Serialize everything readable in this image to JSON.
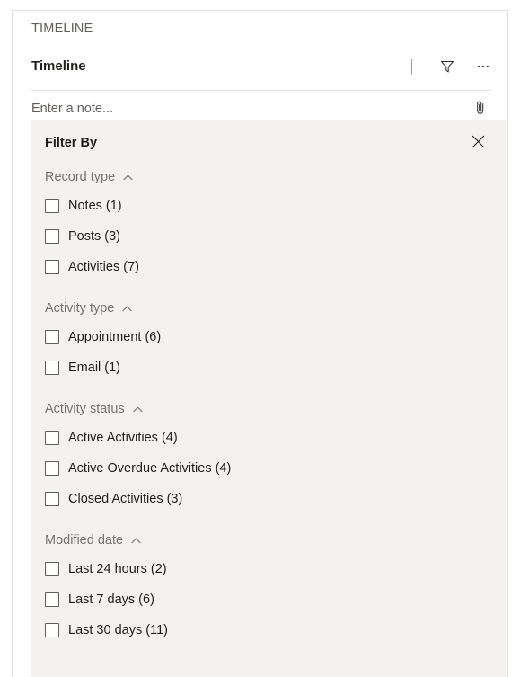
{
  "header": {
    "eyebrow": "TIMELINE",
    "title": "Timeline",
    "commands": [
      {
        "name": "add-timeline-record-button",
        "icon": "plus-icon",
        "label": ""
      },
      {
        "name": "filter-timeline-button",
        "icon": "funnel-icon",
        "label": ""
      },
      {
        "name": "more-commands-button",
        "icon": "ellipsis-icon",
        "label": ""
      }
    ]
  },
  "note": {
    "placeholder": "Enter a note...",
    "value": "",
    "attach_icon": "paperclip-icon"
  },
  "filter": {
    "title": "Filter By",
    "close_icon": "close-icon",
    "chevron_icon": "chevron-up-icon",
    "groups": [
      {
        "label": "Record type",
        "expanded": true,
        "options": [
          {
            "label": "Notes (1)",
            "checked": false
          },
          {
            "label": "Posts (3)",
            "checked": false
          },
          {
            "label": "Activities (7)",
            "checked": false
          }
        ]
      },
      {
        "label": "Activity type",
        "expanded": true,
        "options": [
          {
            "label": "Appointment (6)",
            "checked": false
          },
          {
            "label": "Email (1)",
            "checked": false
          }
        ]
      },
      {
        "label": "Activity status",
        "expanded": true,
        "options": [
          {
            "label": "Active Activities (4)",
            "checked": false
          },
          {
            "label": "Active Overdue Activities (4)",
            "checked": false
          },
          {
            "label": "Closed Activities (3)",
            "checked": false
          }
        ]
      },
      {
        "label": "Modified date",
        "expanded": true,
        "options": [
          {
            "label": "Last 24 hours (2)",
            "checked": false
          },
          {
            "label": "Last 7 days (6)",
            "checked": false
          },
          {
            "label": "Last 30 days (11)",
            "checked": false
          }
        ]
      }
    ]
  },
  "colors": {
    "panel_bg": "#f3f2f1",
    "border": "#e1dfdd",
    "text_primary": "#201f1e",
    "text_secondary": "#605e5c",
    "accent_plus": "#b79a5e"
  }
}
